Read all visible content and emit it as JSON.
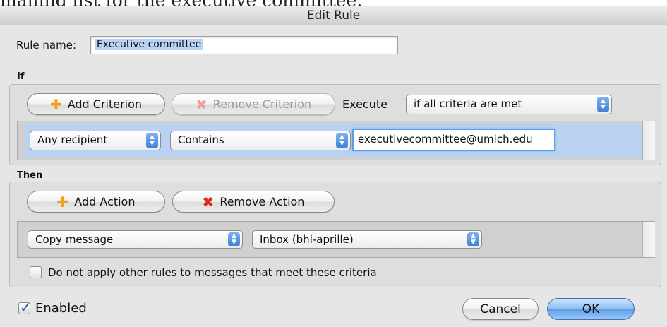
{
  "caption": "mailing list for the executive committee.",
  "window": {
    "title": "Edit Rule"
  },
  "rule_name": {
    "label": "Rule name:",
    "value": "Executive committee"
  },
  "if_section": {
    "heading": "If",
    "add_criterion": "Add Criterion",
    "remove_criterion": "Remove Criterion",
    "execute_label": "Execute",
    "execute_select": "if all criteria are met",
    "criterion": {
      "field": "Any recipient",
      "operator": "Contains",
      "value": "executivecommittee@umich.edu"
    }
  },
  "then_section": {
    "heading": "Then",
    "add_action": "Add Action",
    "remove_action": "Remove Action",
    "action": {
      "type": "Copy message",
      "target": "Inbox (bhl-aprille)"
    },
    "stop_rules_label": "Do not apply other rules to messages that meet these criteria",
    "stop_rules_checked": false
  },
  "footer": {
    "enabled_label": "Enabled",
    "enabled_checked": true,
    "cancel": "Cancel",
    "ok": "OK"
  },
  "icons": {
    "add": "plus-icon",
    "remove": "x-icon",
    "popup": "updown-arrows-icon",
    "check": "checkmark-icon"
  },
  "colors": {
    "add_icon": "#f4a11a",
    "remove_icon": "#e2281e",
    "selection": "#b9d2f1",
    "default_button": "#5c9de6"
  }
}
